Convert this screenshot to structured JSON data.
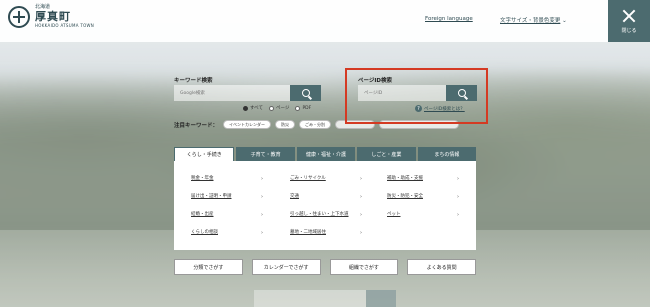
{
  "header": {
    "logo_pref": "北海道",
    "logo_town": "厚真町",
    "logo_en": "HOKKAIDO ATSUMA TOWN",
    "foreign_language": "Foreign language",
    "font_size_color": "文字サイズ・背景色変更",
    "close_label": "閉じる"
  },
  "keyword_search": {
    "label": "キーワード検索",
    "placeholder": "Google検索",
    "options": [
      "すべて",
      "ページ",
      "PDF"
    ],
    "selected": "すべて"
  },
  "hot_keywords": {
    "label": "注目キーワード：",
    "chips": [
      "イベントカレンダー",
      "防災",
      "ごみ・分別"
    ]
  },
  "page_id_search": {
    "label": "ページID検索",
    "placeholder": "ページID",
    "help_link": "ページID検索とは？"
  },
  "categories": {
    "tabs": [
      "くらし・手続き",
      "子育て・教育",
      "健康・福祉・介護",
      "しごと・産業",
      "まちの情報"
    ],
    "active_tab": "くらし・手続き",
    "columns": [
      [
        "税金・年金",
        "届け出・証明・申請",
        "結婚・出産",
        "くらしの相談"
      ],
      [
        "ごみ・リサイクル",
        "交通",
        "引っ越し・住まい・上下水道",
        "墓地・二地域居住"
      ],
      [
        "補助・助成・支援",
        "防災・防犯・安全",
        "ペット"
      ]
    ]
  },
  "bottom_buttons": [
    "分類でさがす",
    "カレンダーでさがす",
    "組織でさがす",
    "よくある質問"
  ],
  "colors": {
    "accent": "#4c6b6f",
    "highlight_border": "#d43a23"
  }
}
